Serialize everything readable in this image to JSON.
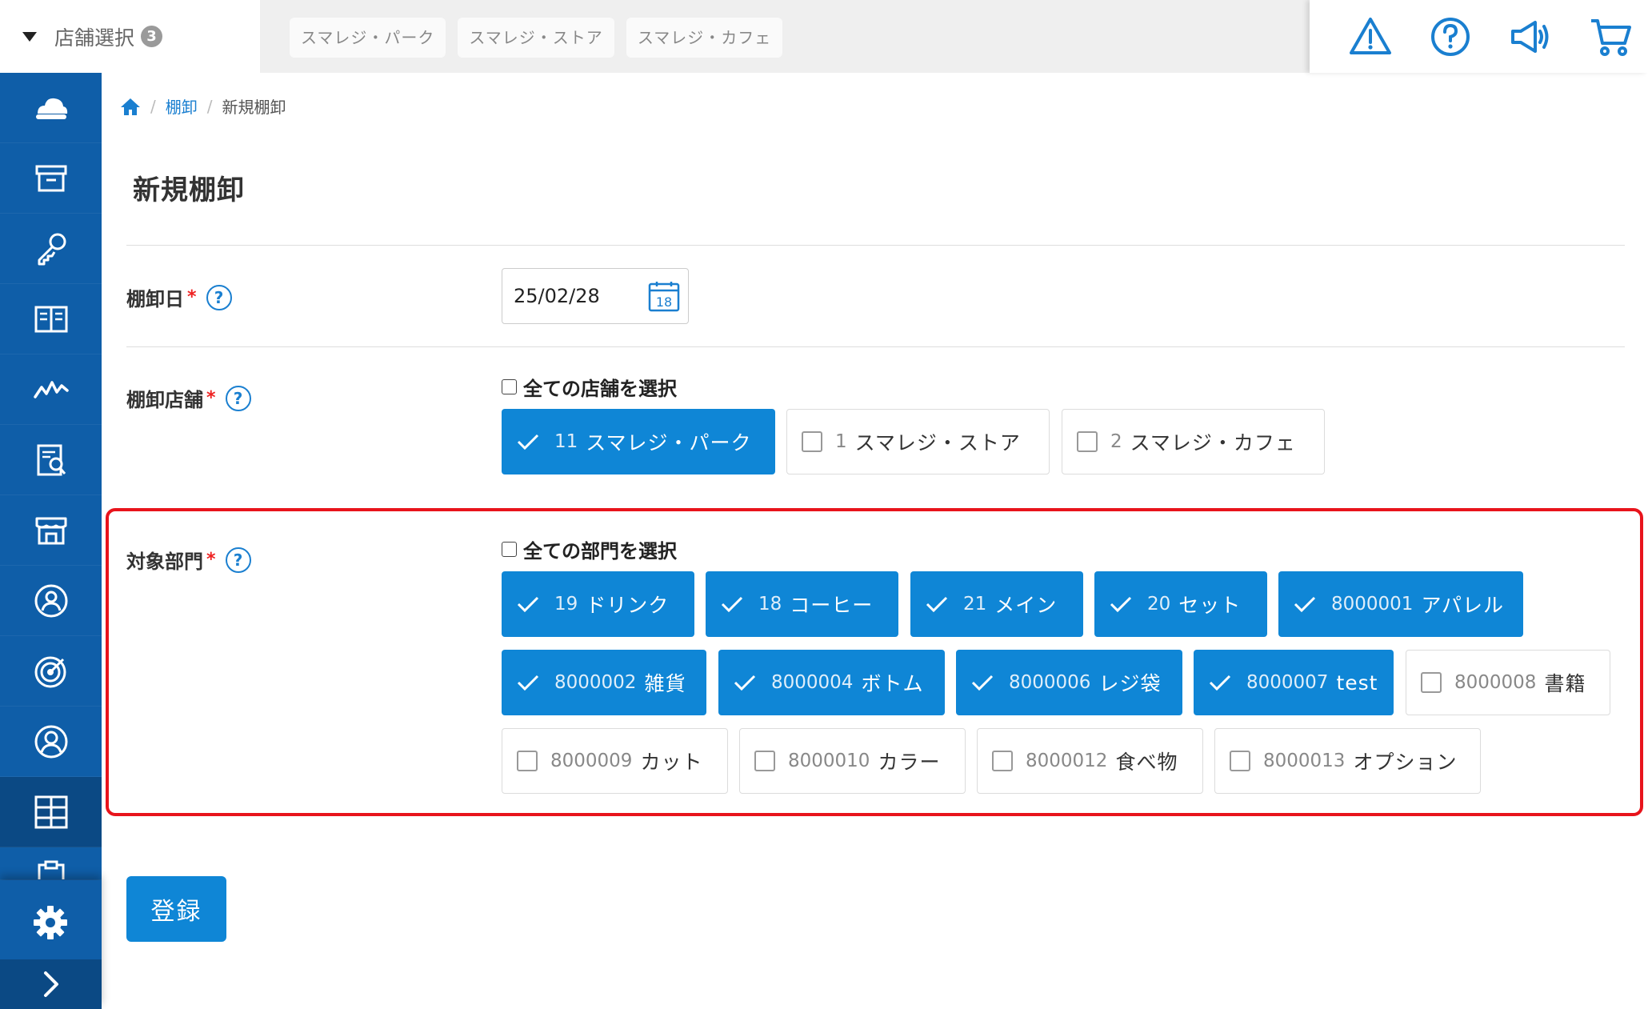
{
  "header": {
    "store_select_label": "店舗選択",
    "store_count": "3",
    "store_tabs": [
      "スマレジ・パーク",
      "スマレジ・ストア",
      "スマレジ・カフェ"
    ],
    "icons": [
      "warning-icon",
      "help-icon",
      "announcement-icon",
      "cart-icon"
    ]
  },
  "sidebar": {
    "items": [
      "cloud-icon",
      "archive-box-icon",
      "key-icon",
      "book-icon",
      "chart-line-icon",
      "report-icon",
      "store-icon",
      "customer-icon",
      "target-icon",
      "user-icon",
      "grid-icon",
      "clipboard-icon"
    ],
    "active_index": 10,
    "settings_icon": "gear-icon",
    "expand_icon": "chevron-right-icon"
  },
  "breadcrumb": {
    "home_icon": "home-icon",
    "parent": "棚卸",
    "current": "新規棚卸"
  },
  "page_title": "新規棚卸",
  "form": {
    "date": {
      "label": "棚卸日",
      "required_mark": "*",
      "help": "?",
      "value": "25/02/28",
      "calendar_day": "18"
    },
    "stores": {
      "label": "棚卸店舗",
      "required_mark": "*",
      "help": "?",
      "select_all": "全ての店舗を選択",
      "options": [
        {
          "code": "11",
          "name": "スマレジ・パーク",
          "checked": true
        },
        {
          "code": "1",
          "name": "スマレジ・ストア",
          "checked": false
        },
        {
          "code": "2",
          "name": "スマレジ・カフェ",
          "checked": false
        }
      ]
    },
    "departments": {
      "label": "対象部門",
      "required_mark": "*",
      "help": "?",
      "select_all": "全ての部門を選択",
      "options": [
        {
          "code": "19",
          "name": "ドリンク",
          "checked": true
        },
        {
          "code": "18",
          "name": "コーヒー",
          "checked": true
        },
        {
          "code": "21",
          "name": "メイン",
          "checked": true
        },
        {
          "code": "20",
          "name": "セット",
          "checked": true
        },
        {
          "code": "8000001",
          "name": "アパレル",
          "checked": true
        },
        {
          "code": "8000002",
          "name": "雑貨",
          "checked": true
        },
        {
          "code": "8000004",
          "name": "ボトム",
          "checked": true
        },
        {
          "code": "8000006",
          "name": "レジ袋",
          "checked": true
        },
        {
          "code": "8000007",
          "name": "test",
          "checked": true
        },
        {
          "code": "8000008",
          "name": "書籍",
          "checked": false
        },
        {
          "code": "8000009",
          "name": "カット",
          "checked": false
        },
        {
          "code": "8000010",
          "name": "カラー",
          "checked": false
        },
        {
          "code": "8000012",
          "name": "食べ物",
          "checked": false
        },
        {
          "code": "8000013",
          "name": "オプション",
          "checked": false
        }
      ]
    },
    "submit_label": "登録"
  },
  "colors": {
    "sidebar": "#0f5ea8",
    "primary": "#0f86d6",
    "highlight": "#e8141c",
    "required": "#e22222"
  }
}
